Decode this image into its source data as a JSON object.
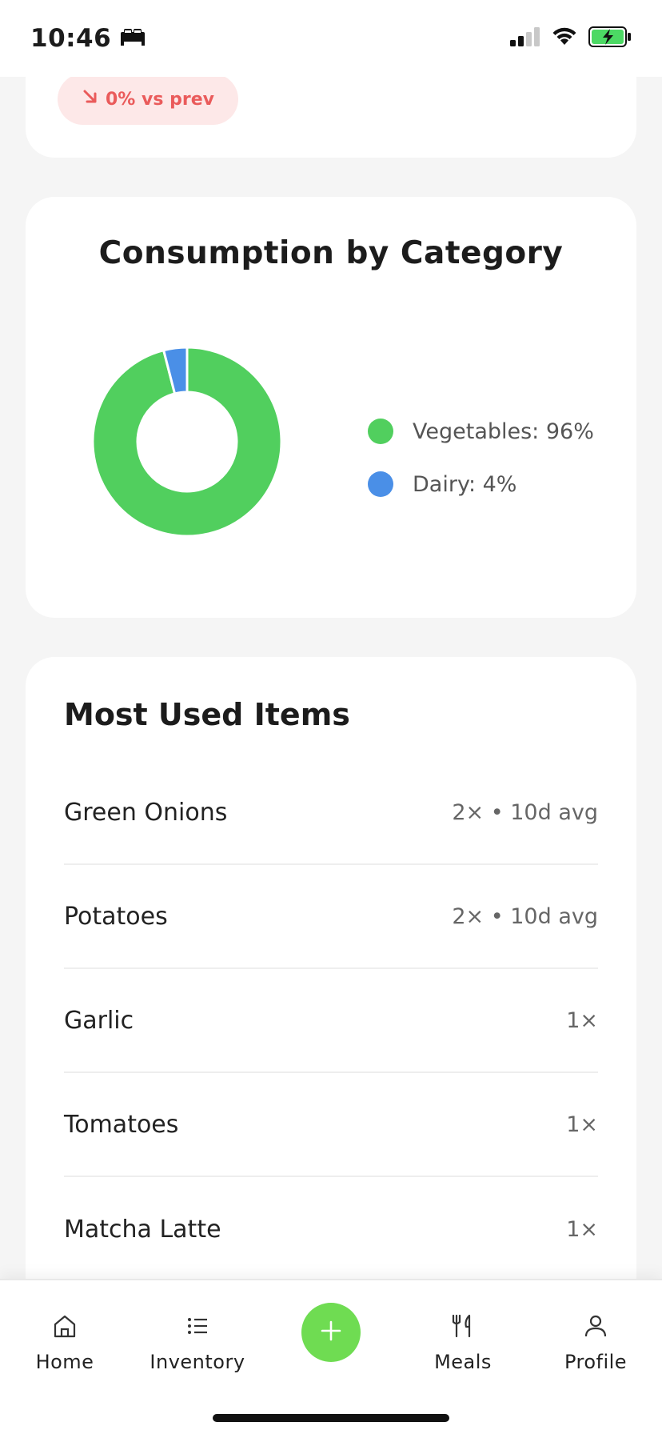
{
  "status_bar": {
    "time": "10:46",
    "icons": [
      "bed-icon",
      "cellular-signal-icon",
      "wifi-icon",
      "battery-charging-icon"
    ]
  },
  "summary_card": {
    "trend_label": "0% vs prev",
    "trend_icon": "arrow-down-right-icon",
    "trend_color": "#ea5b5b"
  },
  "consumption_card": {
    "title": "Consumption by Category",
    "legend": [
      {
        "label": "Vegetables: 96%",
        "color": "#51cf5e"
      },
      {
        "label": "Dairy: 4%",
        "color": "#4a8fe7"
      }
    ]
  },
  "chart_data": {
    "type": "pie",
    "categories": [
      "Vegetables",
      "Dairy"
    ],
    "values": [
      96,
      4
    ],
    "colors": [
      "#51cf5e",
      "#4a8fe7"
    ],
    "title": "Consumption by Category",
    "legend_position": "right"
  },
  "most_used": {
    "title": "Most Used Items",
    "items": [
      {
        "name": "Green Onions",
        "stat": "2× • 10d avg"
      },
      {
        "name": "Potatoes",
        "stat": "2× • 10d avg"
      },
      {
        "name": "Garlic",
        "stat": "1×"
      },
      {
        "name": "Tomatoes",
        "stat": "1×"
      },
      {
        "name": "Matcha Latte",
        "stat": "1×"
      }
    ]
  },
  "bottom_nav": {
    "items": [
      {
        "label": "Home",
        "icon": "home-icon"
      },
      {
        "label": "Inventory",
        "icon": "list-icon"
      },
      {
        "label": "Meals",
        "icon": "fork-knife-icon"
      },
      {
        "label": "Profile",
        "icon": "person-icon"
      }
    ],
    "add_icon": "plus-icon",
    "accent": "#6fdc52"
  }
}
